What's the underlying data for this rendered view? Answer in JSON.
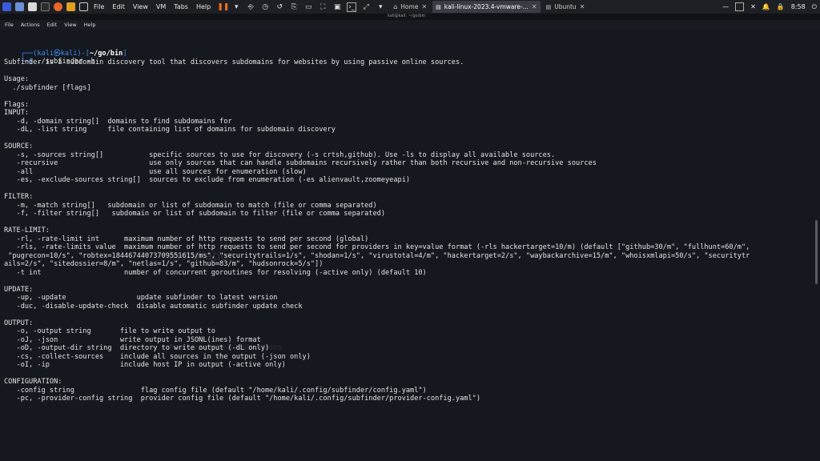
{
  "host_menu": [
    "File",
    "Edit",
    "View",
    "VM",
    "Tabs",
    "Help"
  ],
  "tabs": [
    {
      "label": "Home",
      "active": false
    },
    {
      "label": "kali-linux-2023.4-vmware-...",
      "active": true
    },
    {
      "label": "Ubuntu",
      "active": false
    }
  ],
  "sys_clock": "8:58",
  "vm_title": "kali@kali: ~/go/bin",
  "terminal_menu": [
    "File",
    "Actions",
    "Edit",
    "View",
    "Help"
  ],
  "prompt": {
    "user_host": "┌──(kali㉿kali)-[",
    "path": "~/go/bin",
    "close": "]",
    "symbol": "└─$ ",
    "command": "./subfinder -h"
  },
  "output_lines": [
    "Subfinder is a subdomain discovery tool that discovers subdomains for websites by using passive online sources.",
    "",
    "Usage:",
    "  ./subfinder [flags]",
    "",
    "Flags:",
    "INPUT:",
    "   -d, -domain string[]  domains to find subdomains for",
    "   -dL, -list string     file containing list of domains for subdomain discovery",
    "",
    "SOURCE:",
    "   -s, -sources string[]           specific sources to use for discovery (-s crtsh,github). Use -ls to display all available sources.",
    "   -recursive                      use only sources that can handle subdomains recursively rather than both recursive and non-recursive sources",
    "   -all                            use all sources for enumeration (slow)",
    "   -es, -exclude-sources string[]  sources to exclude from enumeration (-es alienvault,zoomeyeapi)",
    "",
    "FILTER:",
    "   -m, -match string[]   subdomain or list of subdomain to match (file or comma separated)",
    "   -f, -filter string[]   subdomain or list of subdomain to filter (file or comma separated)",
    "",
    "RATE-LIMIT:",
    "   -rl, -rate-limit int      maximum number of http requests to send per second (global)",
    "   -rls, -rate-limits value  maximum number of http requests to send per second for providers in key=value format (-rls hackertarget=10/m) (default [\"github=30/m\", \"fullhunt=60/m\",",
    " \"pugrecon=10/s\", \"robtex=18446744073709551615/ms\", \"securitytrails=1/s\", \"shodan=1/s\", \"virustotal=4/m\", \"hackertarget=2/s\", \"waybackarchive=15/m\", \"whoisxmlapi=50/s\", \"securitytr",
    "ails=2/s\", \"sitedossier=8/m\", \"netlas=1/s\", \"github=83/m\", \"hudsonrock=5/s\"])",
    "   -t int                    number of concurrent goroutines for resolving (-active only) (default 10)",
    "",
    "UPDATE:",
    "   -up, -update                 update subfinder to latest version",
    "   -duc, -disable-update-check  disable automatic subfinder update check",
    "",
    "OUTPUT:",
    "   -o, -output string       file to write output to",
    "   -oJ, -json               write output in JSONL(ines) format",
    "   -oD, -output-dir string  directory to write output (-dL only)",
    "   -cs, -collect-sources    include all sources in the output (-json only)",
    "   -oI, -ip                 include host IP in output (-active only)",
    "",
    "CONFIGURATION:",
    "   -config string                flag config file (default \"/home/kali/.config/subfinder/config.yaml\")",
    "   -pc, -provider-config string  provider config file (default \"/home/kali/.config/subfinder/provider-config.yaml\")"
  ],
  "ghost_text": {
    "heading": "Installation",
    "sub": "Post Installation Instructions"
  },
  "colors": {
    "prompt_blue": "#3a8ff0",
    "terminal_bg": "#16181f",
    "text": "#e4e4e4"
  }
}
